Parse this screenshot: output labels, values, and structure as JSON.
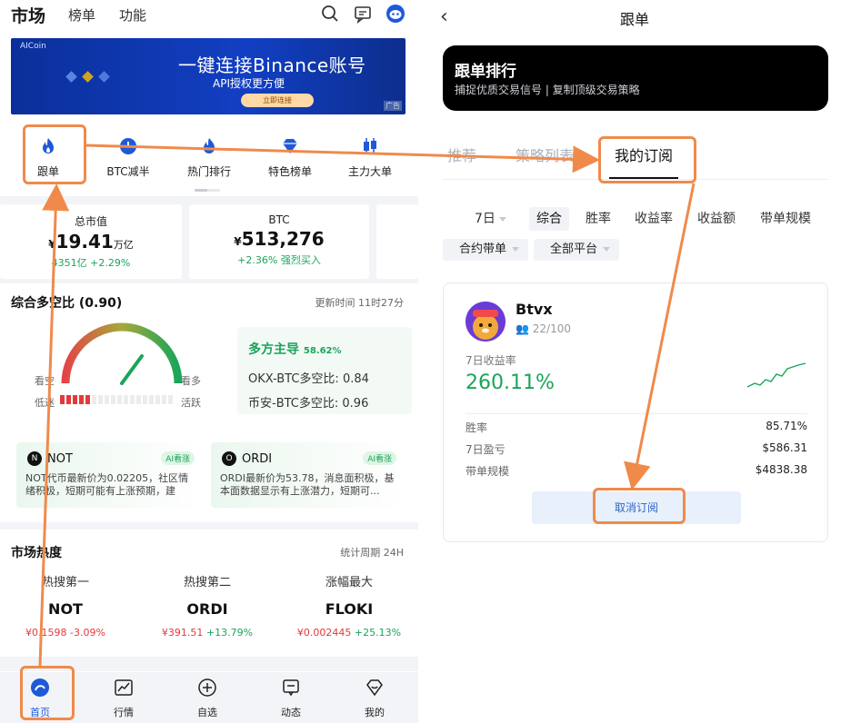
{
  "left": {
    "topbar": {
      "title": "市场",
      "tabs": [
        "榜单",
        "功能"
      ],
      "icons": [
        "search-icon",
        "message-icon",
        "profile-icon"
      ]
    },
    "banner": {
      "logo_text": "AICoin",
      "headline": "一键连接Binance账号",
      "subline": "API授权更方便",
      "cta": "立即连接",
      "ad_tag": "广告"
    },
    "menu": [
      {
        "label": "跟单",
        "icon": "flame-icon"
      },
      {
        "label": "BTC减半",
        "icon": "clock-icon"
      },
      {
        "label": "热门排行",
        "icon": "flame-icon"
      },
      {
        "label": "特色榜单",
        "icon": "diamond-icon"
      },
      {
        "label": "主力大单",
        "icon": "candlestick-icon"
      }
    ],
    "stats": {
      "market_cap": {
        "title": "总市值",
        "currency": "¥",
        "value": "19.41",
        "unit": "万亿",
        "sub_value": "4351亿",
        "sub_change": "+2.29%"
      },
      "btc": {
        "title": "BTC",
        "currency": "¥",
        "value": "513,276",
        "sub_change": "+2.36%",
        "sub_note": "强烈买入"
      }
    },
    "sentiment": {
      "title": "综合多空比 (0.90)",
      "updated": "更新时间 11时27分",
      "gauge_labels": {
        "left_top": "看空",
        "right_top": "看多",
        "left_bottom": "低迷",
        "right_bottom": "活跃"
      },
      "lead_label": "多方主导",
      "lead_pct": "58.62%",
      "rows": [
        {
          "label": "OKX-BTC多空比:",
          "value": "0.84"
        },
        {
          "label": "币安-BTC多空比:",
          "value": "0.96"
        }
      ]
    },
    "ai_cards": [
      {
        "coin": "NOT",
        "tag": "AI看涨",
        "text": "NOT代币最新价为0.02205，社区情绪积极，短期可能有上涨预期，建议..."
      },
      {
        "coin": "ORDI",
        "tag": "AI看涨",
        "text": "ORDI最新价为53.78，消息面积极，基本面数据显示有上涨潜力，短期可..."
      }
    ],
    "heat": {
      "title": "市场热度",
      "period": "统计周期 24H",
      "cols": [
        {
          "label": "热搜第一",
          "symbol": "NOT",
          "price": "¥0.1598",
          "change": "-3.09%",
          "change_dir": "down"
        },
        {
          "label": "热搜第二",
          "symbol": "ORDI",
          "price": "¥391.51",
          "change": "+13.79%",
          "change_dir": "up"
        },
        {
          "label": "涨幅最大",
          "symbol": "FLOKI",
          "price": "¥0.002445",
          "change": "+25.13%",
          "change_dir": "up"
        }
      ]
    },
    "tabbar": [
      {
        "label": "首页",
        "icon": "home-icon",
        "active": true
      },
      {
        "label": "行情",
        "icon": "chart-icon",
        "active": false
      },
      {
        "label": "自选",
        "icon": "plus-circle-icon",
        "active": false
      },
      {
        "label": "动态",
        "icon": "message-icon",
        "active": false
      },
      {
        "label": "我的",
        "icon": "heart-diamond-icon",
        "active": false
      }
    ]
  },
  "right": {
    "title": "跟单",
    "hero": {
      "title": "跟单排行",
      "subtitle": "捕捉优质交易信号 | 复制顶级交易策略"
    },
    "tabs": [
      {
        "label": "推荐",
        "active": false
      },
      {
        "label": "策略列表",
        "active": false
      },
      {
        "label": "我的订阅",
        "active": true
      }
    ],
    "filters": {
      "period": "7日",
      "sorts": [
        "综合",
        "胜率",
        "收益率",
        "收益额",
        "带单规模"
      ],
      "active_sort": "综合",
      "dropdowns": [
        "合约带单",
        "全部平台"
      ]
    },
    "trader": {
      "name": "Btvx",
      "followers": "22/100",
      "roi_label": "7日收益率",
      "roi": "260.11%",
      "stats": [
        {
          "label": "胜率",
          "value": "85.71%"
        },
        {
          "label": "7日盈亏",
          "value": "$586.31"
        },
        {
          "label": "带单规模",
          "value": "$4838.38"
        }
      ],
      "unsubscribe": "取消订阅"
    }
  },
  "colors": {
    "accent_orange": "#f08a4b",
    "up_green": "#1aa55a",
    "down_red": "#e23a3a",
    "primary_blue": "#1e59d8"
  }
}
